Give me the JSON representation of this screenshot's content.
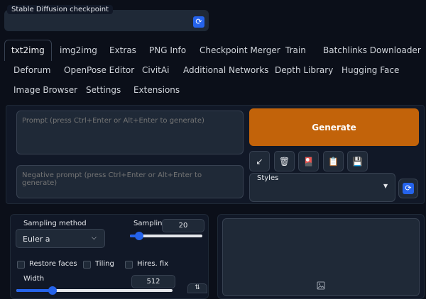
{
  "checkpoint": {
    "label": "Stable Diffusion checkpoint",
    "refresh_icon": "refresh-icon"
  },
  "tabs_row1": [
    "txt2img",
    "img2img",
    "Extras",
    "PNG Info",
    "Checkpoint Merger",
    "Train",
    "Batchlinks Downloader"
  ],
  "tabs_row2": [
    "Deforum",
    "OpenPose Editor",
    "CivitAi",
    "Additional Networks",
    "Depth Library",
    "Hugging Face"
  ],
  "tabs_row3": [
    "Image Browser",
    "Settings",
    "Extensions"
  ],
  "prompt": {
    "placeholder": "Prompt (press Ctrl+Enter or Alt+Enter to generate)"
  },
  "negative_prompt": {
    "placeholder": "Negative prompt (press Ctrl+Enter or Alt+Enter to generate)"
  },
  "generate": {
    "label": "Generate"
  },
  "tools": {
    "arrow": "↙",
    "trash": "🗑",
    "card": "🎴",
    "clipboard": "📋",
    "save": "💾"
  },
  "styles": {
    "label": "Styles"
  },
  "sampling": {
    "method_label": "Sampling method",
    "method_value": "Euler a",
    "steps_label": "Sampling",
    "steps_value": "20",
    "steps_fraction": 0.13
  },
  "checkboxes": {
    "restore_faces": "Restore faces",
    "tiling": "Tiling",
    "hires_fix": "Hires. fix"
  },
  "width": {
    "label": "Width",
    "value": "512",
    "fraction": 0.23
  },
  "colors": {
    "accent": "#2563eb",
    "generate": "#c2630a",
    "bg": "#0b0f19"
  }
}
